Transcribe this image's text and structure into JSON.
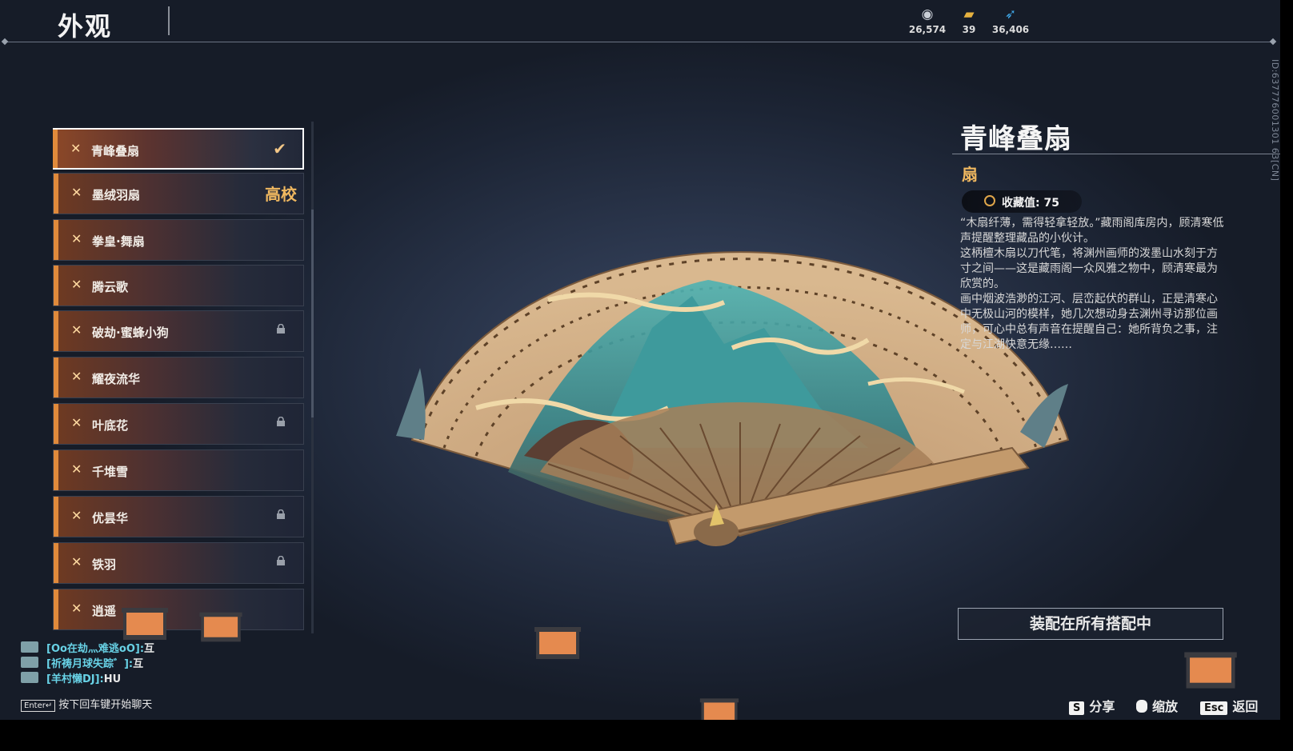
{
  "header": {
    "title": "外观",
    "currencies": [
      {
        "icon": "silver-coin-icon",
        "value": "26,574"
      },
      {
        "icon": "gold-ingot-icon",
        "value": "39"
      },
      {
        "icon": "feather-icon",
        "value": "36,406"
      }
    ],
    "user_id": "ID:637776001301 63[CN]"
  },
  "list": {
    "items": [
      {
        "name": "青峰叠扇",
        "state": "selected"
      },
      {
        "name": "墨绒羽扇",
        "badge": "高校"
      },
      {
        "name": "拳皇·舞扇"
      },
      {
        "name": "腾云歌"
      },
      {
        "name": "破劫·蜜蜂小狗",
        "locked": true
      },
      {
        "name": "耀夜流华"
      },
      {
        "name": "叶底花",
        "locked": true
      },
      {
        "name": "千堆雪"
      },
      {
        "name": "优昙华",
        "locked": true
      },
      {
        "name": "铁羽",
        "locked": true
      },
      {
        "name": "逍遥"
      }
    ]
  },
  "chat": {
    "messages": [
      {
        "name": "[Oo在劫灬难逃oO]:",
        "text": "互"
      },
      {
        "name": "[祈祷月球失踪゛]:",
        "text": "互"
      },
      {
        "name": "[羊村懒DJ]:",
        "text": "HU"
      }
    ],
    "enter_key": "Enter↵",
    "enter_hint": "按下回车键开始聊天"
  },
  "detail": {
    "title": "青峰叠扇",
    "type": "扇",
    "collect_label": "收藏值:",
    "collect_value": "75",
    "description": [
      "“木扇纤薄，需得轻拿轻放。”藏雨阁库房内，顾清寒低声提醒整理藏品的小伙计。",
      "这柄檀木扇以刀代笔，将渊州画师的泼墨山水刻于方寸之间——这是藏雨阁一众风雅之物中，顾清寒最为欣赏的。",
      "画中烟波浩渺的江河、层峦起伏的群山，正是清寒心中无极山河的模样，她几次想动身去渊州寻访那位画师，可心中总有声音在提醒自己：她所背负之事，注定与江湖快意无缘……"
    ],
    "equip_button": "装配在所有搭配中"
  },
  "footer": {
    "share_key": "S",
    "share_label": "分享",
    "zoom_label": "缩放",
    "back_key": "Esc",
    "back_label": "返回"
  },
  "colors": {
    "accent_orange": "#e08a3b",
    "gold_text": "#f0b860",
    "chat_name": "#68d2e6"
  }
}
